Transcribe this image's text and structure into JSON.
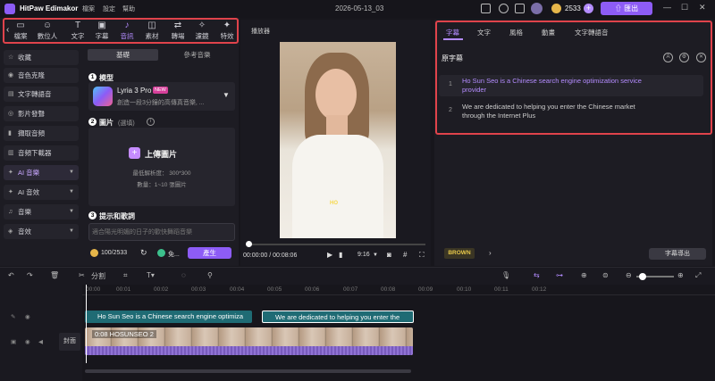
{
  "titlebar": {
    "app_name": "HitPaw Edimakor",
    "menu": [
      "檔案",
      "設定",
      "幫助"
    ],
    "project_name": "2026-05-13_03",
    "credits": "2533",
    "export_label": "匯出"
  },
  "toolbar": {
    "items": [
      {
        "label": "檔案",
        "icon": "folder-icon"
      },
      {
        "label": "數位人",
        "icon": "avatar-icon"
      },
      {
        "label": "文字",
        "icon": "text-icon"
      },
      {
        "label": "字幕",
        "icon": "subtitle-icon"
      },
      {
        "label": "音訊",
        "icon": "music-icon"
      },
      {
        "label": "素材",
        "icon": "material-icon"
      },
      {
        "label": "轉場",
        "icon": "transition-icon"
      },
      {
        "label": "濾鏡",
        "icon": "filter-icon"
      },
      {
        "label": "特效",
        "icon": "effects-icon"
      }
    ]
  },
  "sidebar": {
    "items": [
      {
        "label": "收藏",
        "icon": "star-icon"
      },
      {
        "label": "音色克隆",
        "icon": "voice-clone-icon"
      },
      {
        "label": "文字轉語音",
        "icon": "tts-icon"
      },
      {
        "label": "影片發聲",
        "icon": "video-voice-icon"
      },
      {
        "label": "擷取音頻",
        "icon": "extract-audio-icon"
      },
      {
        "label": "音頻下載器",
        "icon": "audio-download-icon"
      },
      {
        "label": "AI 音樂",
        "icon": "ai-music-icon"
      },
      {
        "label": "AI 音效",
        "icon": "ai-sfx-icon"
      },
      {
        "label": "音樂",
        "icon": "music-note-icon"
      },
      {
        "label": "音效",
        "icon": "sfx-icon"
      }
    ]
  },
  "panel": {
    "tabs": [
      "基礎",
      "參考音樂"
    ],
    "model_section": "模型",
    "model_name": "Lyria 3 Pro",
    "model_badge": "NEW",
    "model_desc": "創造一段3分鐘的高傳真音樂, ...",
    "image_section": "圖片",
    "image_optional": "(選填)",
    "upload_title": "上傳圖片",
    "upload_min": "最低解析度： 300*300",
    "upload_count": "數量：1~10 張圖片",
    "prompt_section": "提示和歌詞",
    "prompt_placeholder": "適合陽光明媚的日子的歡快舞蹈音樂",
    "cost": "100/2533",
    "free_label": "免...",
    "generate_label": "產生"
  },
  "player": {
    "title": "播放器",
    "subtitle_preview": "HO",
    "time": "00:00:00 / 00:08:06",
    "ratio": "9:16"
  },
  "right_panel": {
    "tabs": [
      "字幕",
      "文字",
      "風格",
      "動畫",
      "文字轉語音"
    ],
    "original_title": "原字幕",
    "subtitles": [
      {
        "num": "1",
        "text": "Ho Sun Seo is a Chinese search engine optimization service provider"
      },
      {
        "num": "2",
        "text": "We are dedicated to helping you enter the Chinese market through the Internet Plus"
      }
    ],
    "style_preset": "BROWN",
    "export_subtitles": "字幕導出"
  },
  "timeline": {
    "split_label": "分割",
    "ruler": [
      "00:00",
      "00:01",
      "00:02",
      "00:03",
      "00:04",
      "00:05",
      "00:06",
      "00:07",
      "00:08",
      "00:09",
      "00:10",
      "00:11",
      "00:12"
    ],
    "sub_clip_1": "Ho Sun Seo is a Chinese search engine optimiza",
    "sub_clip_2": "We are dedicated to helping you enter the",
    "video_clip_label": "0:08 HOSUNSEO 2",
    "cover_label": "封面"
  },
  "colors": {
    "accent": "#8d5cf6",
    "highlight_border": "#e0434b",
    "subtitle_clip": "#1f6b74"
  }
}
